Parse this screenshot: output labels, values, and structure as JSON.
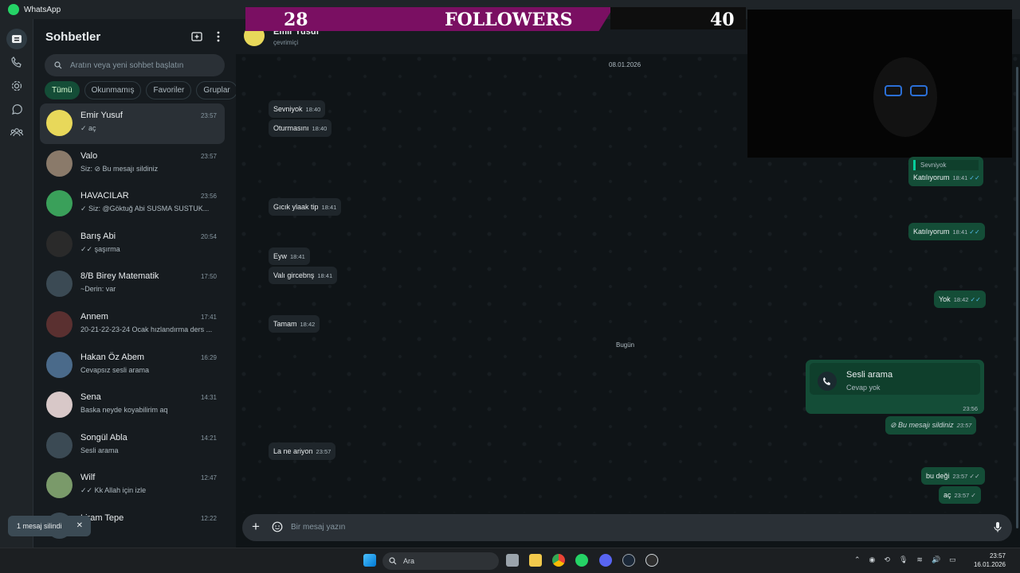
{
  "window": {
    "title": "WhatsApp"
  },
  "sidebar": {
    "title": "Sohbetler",
    "search_placeholder": "Aratın veya yeni sohbet başlatın",
    "filters": [
      "Tümü",
      "Okunmamış",
      "Favoriler",
      "Gruplar"
    ],
    "chats": [
      {
        "name": "Emir Yusuf",
        "time": "23:57",
        "preview": "✓ aç",
        "avatar_color": "#e8d85a"
      },
      {
        "name": "Valo",
        "time": "23:57",
        "preview": "Siz: ⊘ Bu mesajı sildiniz",
        "avatar_color": "#8a7a6a"
      },
      {
        "name": "HAVACILAR",
        "time": "23:56",
        "preview": "✓ Siz: @Göktuğ Abi  SUSMA SUSTUK...",
        "avatar_color": "#3aa05a"
      },
      {
        "name": "Barış Abi",
        "time": "20:54",
        "preview": "✓✓ şaşırma",
        "avatar_color": "#2a2a2a"
      },
      {
        "name": "8/B Birey Matematik",
        "time": "17:50",
        "preview": "~Derin: var",
        "avatar_color": "#3b4a54"
      },
      {
        "name": "Annem",
        "time": "17:41",
        "preview": "20-21-22-23-24 Ocak hızlandırma ders ...",
        "avatar_color": "#5a3030"
      },
      {
        "name": "Hakan Öz Abem",
        "time": "16:29",
        "preview": "Cevapsız sesli arama",
        "avatar_color": "#4a6a8a"
      },
      {
        "name": "Sena",
        "time": "14:31",
        "preview": "Baska neyde koyabilirim aq",
        "avatar_color": "#d8c8c8"
      },
      {
        "name": "Songül Abla",
        "time": "14:21",
        "preview": "Sesli arama",
        "avatar_color": "#3b4a54"
      },
      {
        "name": "Wilf",
        "time": "12:47",
        "preview": "✓✓ Kk Allah için izle",
        "avatar_color": "#7a9a6a"
      },
      {
        "name": "Liram Tepe",
        "time": "12:22",
        "preview": "3b",
        "avatar_color": "#3b4a54"
      }
    ],
    "toast": "1 mesaj silindi"
  },
  "conversation": {
    "contact_name": "Emir Yusuf",
    "status": "çevrimiçi",
    "date_chip_1": "08.01.2026",
    "date_chip_2": "Bugün",
    "messages_in": [
      {
        "text": "Sevniyok",
        "time": "18:40"
      },
      {
        "text": "Oturmasını",
        "time": "18:40"
      },
      {
        "text": "Gıcık ylaak tip",
        "time": "18:41"
      },
      {
        "text": "Eyw",
        "time": "18:41"
      },
      {
        "text": "Valı gircebnş",
        "time": "18:41"
      },
      {
        "text": "Tamam",
        "time": "18:42"
      },
      {
        "text": "La ne ariyon",
        "time": "23:57"
      }
    ],
    "messages_out": [
      {
        "quote": "Sevniyok",
        "text": "Katılıyorum",
        "time": "18:41"
      },
      {
        "text": "Katılıyorum",
        "time": "18:41"
      },
      {
        "text": "Yok",
        "time": "18:42"
      },
      {
        "text": "Bu mesajı sildiniz",
        "time": "23:57"
      },
      {
        "text": "bu deği",
        "time": "23:57"
      },
      {
        "text": "aç",
        "time": "23:57"
      }
    ],
    "call": {
      "title": "Sesli arama",
      "subtitle": "Cevap yok",
      "time": "23:56"
    },
    "composer_placeholder": "Bir mesaj yazın"
  },
  "overlay": {
    "left_count": "28",
    "label": "FOLLOWERS",
    "right_count": "40"
  },
  "taskbar": {
    "search": "Ara",
    "time": "23:57",
    "date": "16.01.2026"
  }
}
